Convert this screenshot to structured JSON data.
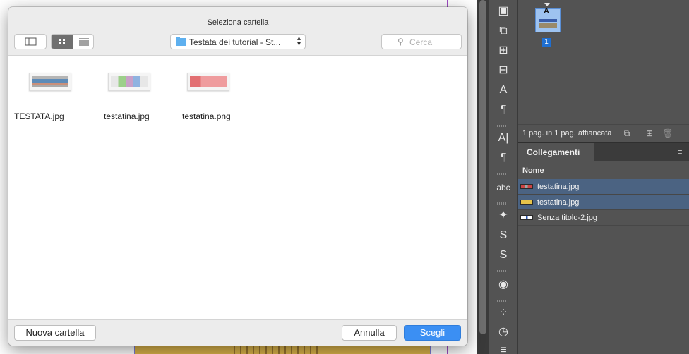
{
  "dialog": {
    "title": "Seleziona cartella",
    "path": "Testata dei tutorial - St...",
    "search_placeholder": "Cerca",
    "files": [
      {
        "name": "TESTATA.jpg"
      },
      {
        "name": "testatina.jpg"
      },
      {
        "name": "testatina.png"
      }
    ],
    "new_folder_label": "Nuova cartella",
    "cancel_label": "Annulla",
    "choose_label": "Scegli"
  },
  "pages_panel": {
    "master_letter": "A",
    "page_number": "1",
    "status_text": "1 pag. in 1 pag. affiancata"
  },
  "links_panel": {
    "tab_label": "Collegamenti",
    "column_name": "Nome",
    "rows": [
      {
        "name": "testatina.jpg",
        "selected": true
      },
      {
        "name": "testatina.jpg",
        "selected": true
      },
      {
        "name": "Senza titolo-2.jpg",
        "selected": false
      }
    ]
  },
  "colors": {
    "accent": "#3b8ff3",
    "selection": "#4b6382",
    "panel": "#535353"
  },
  "icons": {
    "toolbar": [
      "pages-icon",
      "layers-icon",
      "links-icon",
      "stroke-icon",
      "character-styles-icon",
      "paragraph-styles-icon",
      "character-icon",
      "paragraph-icon",
      "glyphs-icon",
      "spelling-icon",
      "swatches-icon",
      "effects-icon",
      "gradient-icon",
      "color-icon",
      "scripts-icon",
      "timer-icon"
    ]
  }
}
